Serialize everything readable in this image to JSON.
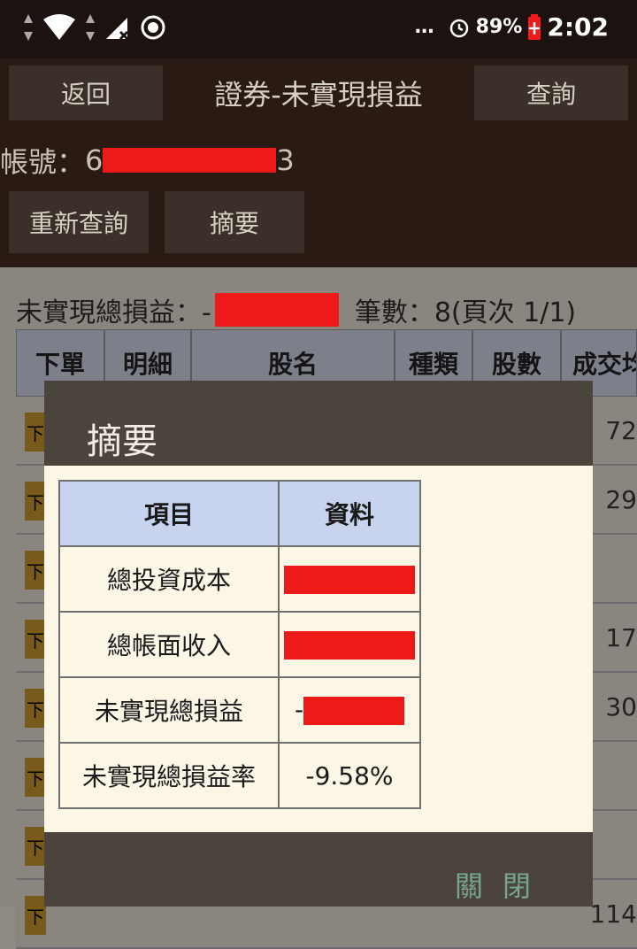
{
  "status_bar": {
    "time": "2:02",
    "battery": "89%",
    "more": "…",
    "icons": [
      "data-arrows-icon",
      "wifi-icon",
      "data-arrows-icon",
      "cell-signal-icon",
      "record-icon",
      "alarm-icon",
      "battery-icon"
    ]
  },
  "header": {
    "back": "返回",
    "title": "證券-未實現損益",
    "query": "查詢",
    "account_label": "帳號：",
    "account_prefix": "6",
    "account_suffix": "3",
    "requery": "重新查詢",
    "summary": "摘要"
  },
  "list": {
    "total_label": "未實現總損益：-",
    "count_text": "筆數：8(頁次 1/1)",
    "columns": [
      "下單",
      "明細",
      "股名",
      "種類",
      "股數",
      "成交均"
    ],
    "rows": [
      {
        "order": "下",
        "price": "72"
      },
      {
        "order": "下",
        "price": "29"
      },
      {
        "order": "下",
        "price": ""
      },
      {
        "order": "下",
        "price": "17"
      },
      {
        "order": "下",
        "price": "30"
      },
      {
        "order": "下",
        "price": ""
      },
      {
        "order": "下",
        "price": ""
      },
      {
        "order": "下",
        "price": "114"
      }
    ]
  },
  "dialog": {
    "title": "摘要",
    "head_item": "項目",
    "head_data": "資料",
    "rows": [
      {
        "label": "總投資成本",
        "value": ""
      },
      {
        "label": "總帳面收入",
        "value": ""
      },
      {
        "label": "未實現總損益",
        "value": "-"
      },
      {
        "label": "未實現總損益率",
        "value": "-9.58%"
      }
    ],
    "close": "關閉"
  },
  "colors": {
    "header_bg": "#2a1a14",
    "dialog_header": "#4b443d",
    "table_head": "#c8d3ee",
    "redaction": "#ee1a1a",
    "rate_green": "#168a16",
    "close_text": "#78a58a"
  }
}
